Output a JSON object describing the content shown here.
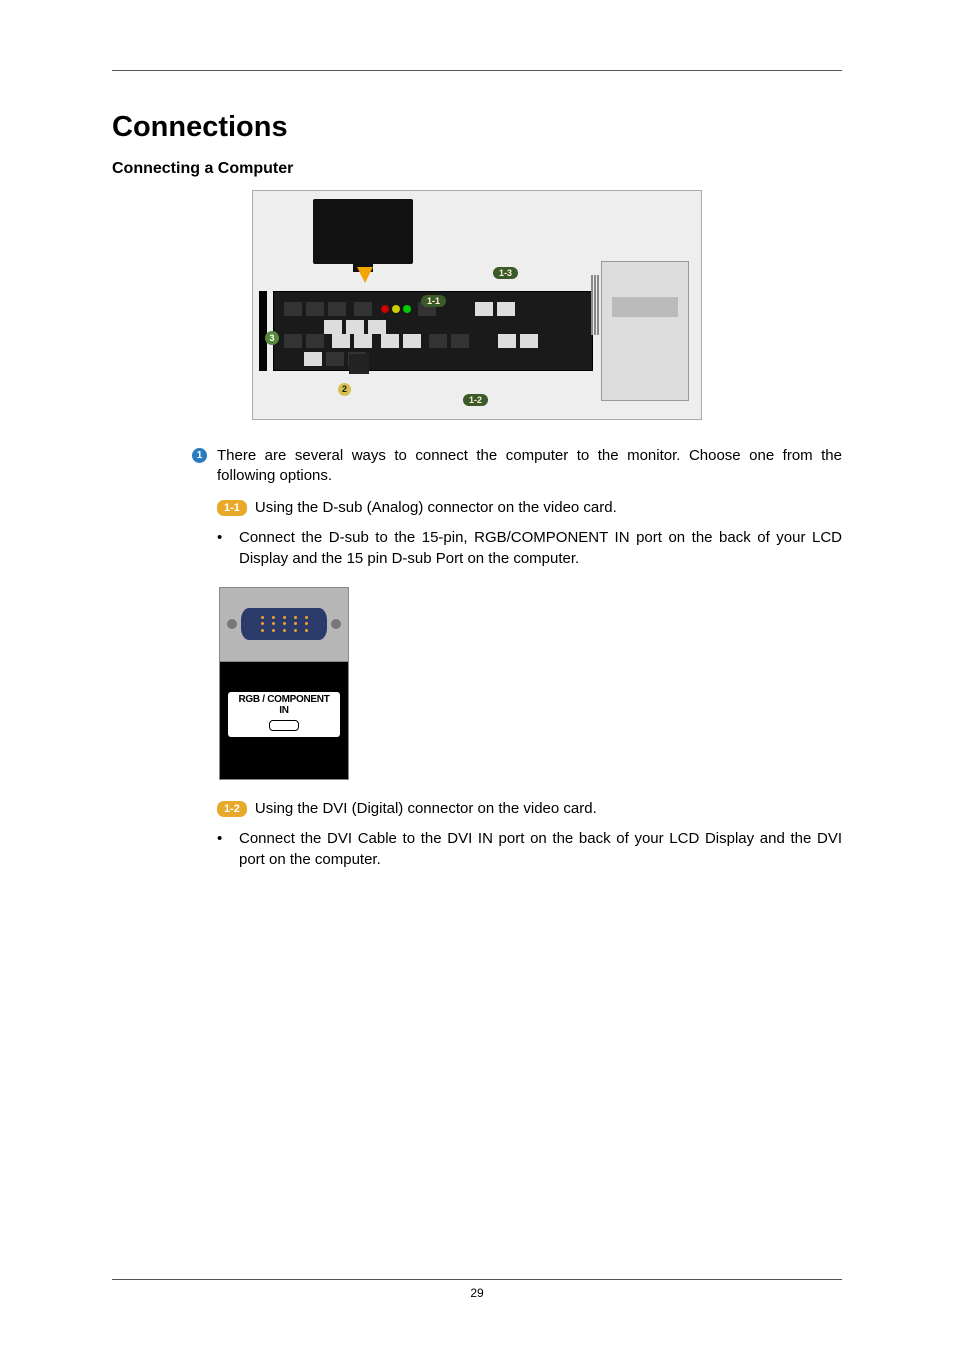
{
  "page": {
    "title": "Connections",
    "section": "Connecting a Computer",
    "number": "29"
  },
  "diagram": {
    "badges": {
      "b11": "1-1",
      "b12": "1-2",
      "b13": "1-3",
      "b2": "2",
      "b3": "3"
    }
  },
  "item1": {
    "bullet": "1",
    "text": "There are several ways to connect the computer to the monitor. Choose one from the following options.",
    "sub11": {
      "pill": "1-1",
      "text": "Using the D-sub (Analog) connector on the video card.",
      "li": "Connect the D-sub to the 15-pin, RGB/COMPONENT IN port on the back of your LCD Display and the 15 pin D-sub Port on the computer."
    },
    "portLabel": {
      "line1": "RGB / COMPONENT",
      "line2": "IN"
    },
    "sub12": {
      "pill": "1-2",
      "text": "Using the DVI (Digital) connector on the video card.",
      "li": "Connect the DVI Cable to the DVI IN port on the back of your LCD Display and the DVI port on the computer."
    }
  }
}
